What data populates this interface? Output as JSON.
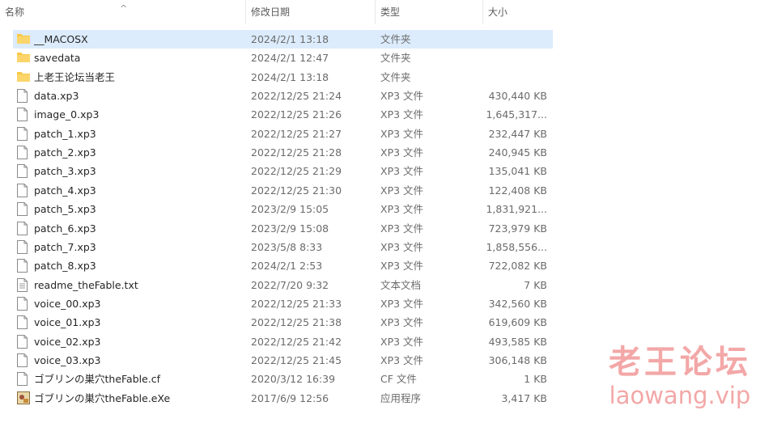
{
  "columns": {
    "name": "名称",
    "date": "修改日期",
    "type": "类型",
    "size": "大小"
  },
  "files": [
    {
      "name": "__MACOSX",
      "date": "2024/2/1 13:18",
      "type": "文件夹",
      "size": "",
      "icon": "folder-icon",
      "selected": true
    },
    {
      "name": "savedata",
      "date": "2024/2/1 12:47",
      "type": "文件夹",
      "size": "",
      "icon": "folder-icon"
    },
    {
      "name": "上老王论坛当老王",
      "date": "2024/2/1 13:18",
      "type": "文件夹",
      "size": "",
      "icon": "folder-icon"
    },
    {
      "name": "data.xp3",
      "date": "2022/12/25 21:24",
      "type": "XP3 文件",
      "size": "430,440 KB",
      "icon": "file-icon"
    },
    {
      "name": "image_0.xp3",
      "date": "2022/12/25 21:26",
      "type": "XP3 文件",
      "size": "1,645,317...",
      "icon": "file-icon"
    },
    {
      "name": "patch_1.xp3",
      "date": "2022/12/25 21:27",
      "type": "XP3 文件",
      "size": "232,447 KB",
      "icon": "file-icon"
    },
    {
      "name": "patch_2.xp3",
      "date": "2022/12/25 21:28",
      "type": "XP3 文件",
      "size": "240,945 KB",
      "icon": "file-icon"
    },
    {
      "name": "patch_3.xp3",
      "date": "2022/12/25 21:29",
      "type": "XP3 文件",
      "size": "135,041 KB",
      "icon": "file-icon"
    },
    {
      "name": "patch_4.xp3",
      "date": "2022/12/25 21:30",
      "type": "XP3 文件",
      "size": "122,408 KB",
      "icon": "file-icon"
    },
    {
      "name": "patch_5.xp3",
      "date": "2023/2/9 15:05",
      "type": "XP3 文件",
      "size": "1,831,921...",
      "icon": "file-icon"
    },
    {
      "name": "patch_6.xp3",
      "date": "2023/2/9 15:08",
      "type": "XP3 文件",
      "size": "723,979 KB",
      "icon": "file-icon"
    },
    {
      "name": "patch_7.xp3",
      "date": "2023/5/8 8:33",
      "type": "XP3 文件",
      "size": "1,858,556...",
      "icon": "file-icon"
    },
    {
      "name": "patch_8.xp3",
      "date": "2024/2/1 2:53",
      "type": "XP3 文件",
      "size": "722,082 KB",
      "icon": "file-icon"
    },
    {
      "name": "readme_theFable.txt",
      "date": "2022/7/20 9:32",
      "type": "文本文档",
      "size": "7 KB",
      "icon": "text-file-icon"
    },
    {
      "name": "voice_00.xp3",
      "date": "2022/12/25 21:33",
      "type": "XP3 文件",
      "size": "342,560 KB",
      "icon": "file-icon"
    },
    {
      "name": "voice_01.xp3",
      "date": "2022/12/25 21:38",
      "type": "XP3 文件",
      "size": "619,609 KB",
      "icon": "file-icon"
    },
    {
      "name": "voice_02.xp3",
      "date": "2022/12/25 21:42",
      "type": "XP3 文件",
      "size": "493,585 KB",
      "icon": "file-icon"
    },
    {
      "name": "voice_03.xp3",
      "date": "2022/12/25 21:45",
      "type": "XP3 文件",
      "size": "306,148 KB",
      "icon": "file-icon"
    },
    {
      "name": "ゴブリンの巣穴theFable.cf",
      "date": "2020/3/12 16:39",
      "type": "CF 文件",
      "size": "1 KB",
      "icon": "file-icon"
    },
    {
      "name": "ゴブリンの巣穴theFable.eXe",
      "date": "2017/6/9 12:56",
      "type": "应用程序",
      "size": "3,417 KB",
      "icon": "app-icon"
    }
  ],
  "watermark": {
    "title": "老王论坛",
    "url": "laowang.vip"
  },
  "colors": {
    "selection": "#dcecfc",
    "folder": "#f7c948",
    "watermark": "#f08a8a"
  }
}
